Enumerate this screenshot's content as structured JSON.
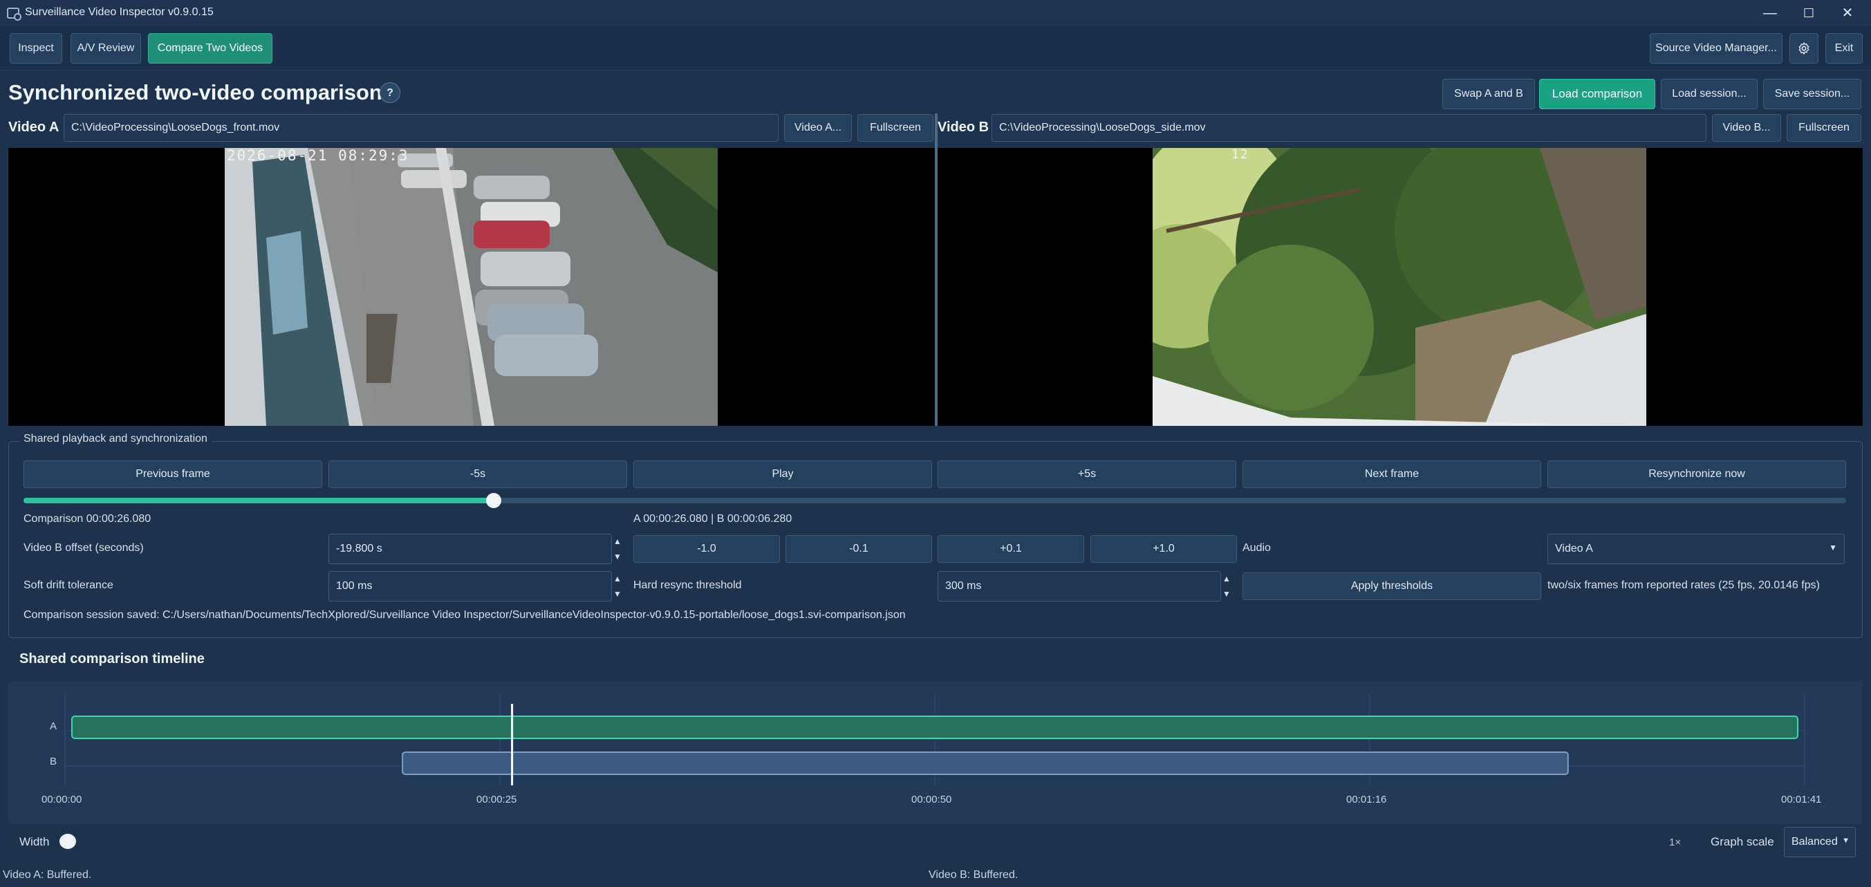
{
  "window": {
    "title": "Surveillance Video Inspector v0.9.0.15",
    "controls": [
      "—",
      "☐",
      "✕"
    ]
  },
  "nav": {
    "tabs": [
      "Inspect",
      "A/V Review",
      "Compare Two Videos"
    ],
    "active_tab": "Compare Two Videos",
    "source_manager": "Source Video Manager...",
    "settings_icon": "gear-icon",
    "exit": "Exit"
  },
  "header": {
    "title": "Synchronized two-video comparison",
    "help": "?",
    "swap": "Swap A and B",
    "load_comparison": "Load comparison",
    "load_session": "Load session...",
    "save_session": "Save session..."
  },
  "video_a": {
    "label": "Video A",
    "path": "C:\\VideoProcessing\\LooseDogs_front.mov",
    "select": "Video A...",
    "fullscreen": "Fullscreen",
    "timestamp": "2026-08-21 08:29:3"
  },
  "video_b": {
    "label": "Video B",
    "path": "C:\\VideoProcessing\\LooseDogs_side.mov",
    "select": "Video B...",
    "fullscreen": "Fullscreen",
    "timestamp": "12"
  },
  "playback": {
    "title": "Shared playback and synchronization",
    "buttons": [
      "Previous frame",
      "-5s",
      "Play",
      "+5s",
      "Next frame",
      "Resynchronize now"
    ],
    "progress": 0.258,
    "comparison_time": "Comparison 00:00:26.080",
    "ab_time": "A 00:00:26.080  |  B 00:00:06.280",
    "offset_label": "Video B offset (seconds)",
    "offset_value": "-19.800 s",
    "offset_buttons": [
      "-1.0",
      "-0.1",
      "+0.1",
      "+1.0"
    ],
    "audio_label": "Audio",
    "audio_value": "Video A",
    "soft_label": "Soft drift tolerance",
    "soft_value": "100 ms",
    "hard_label": "Hard resync threshold",
    "hard_value": "300 ms",
    "apply": "Apply thresholds",
    "rates_note": "two/six frames from reported rates (25 fps, 20.0146 fps)",
    "session_saved": "Comparison session saved: C:/Users/nathan/Documents/TechXplored/Surveillance Video Inspector/SurveillanceVideoInspector-v0.9.0.15-portable/loose_dogs1.svi-comparison.json"
  },
  "timeline": {
    "title": "Shared comparison timeline",
    "track_labels": [
      "A",
      "B"
    ],
    "ticks": [
      "00:00:00",
      "00:00:25",
      "00:00:50",
      "00:01:16",
      "00:01:41"
    ],
    "track_a": {
      "start": 0.0,
      "end": 1.0
    },
    "track_b": {
      "start": 0.194,
      "end": 0.864
    },
    "playhead": 0.257
  },
  "footer": {
    "width_label": "Width",
    "zoom": "1×",
    "graph_scale_label": "Graph scale",
    "graph_scale_value": "Balanced"
  },
  "status": {
    "a": "Video A: Buffered.",
    "b": "Video B: Buffered."
  }
}
